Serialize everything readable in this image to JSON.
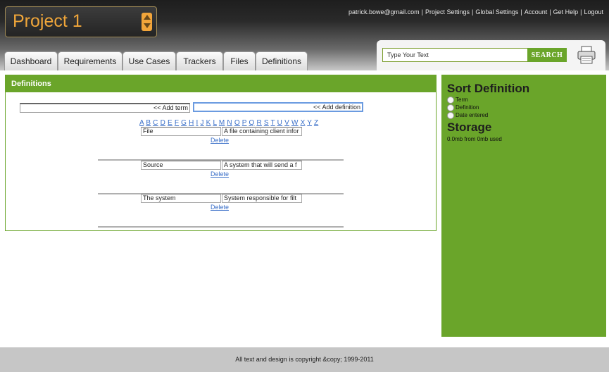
{
  "project": {
    "name": "Project 1"
  },
  "topnav": {
    "email": "patrick.bowe@gmail.com",
    "links": [
      "Project Settings",
      "Global Settings",
      "Account",
      "Get Help",
      "Logout"
    ]
  },
  "tabs": [
    "Dashboard",
    "Requirements",
    "Use Cases",
    "Trackers",
    "Files",
    "Definitions"
  ],
  "search": {
    "placeholder": "Type Your Text",
    "button_label": "SEARCH"
  },
  "definitions": {
    "header": "Definitions",
    "add_term": "<< Add term",
    "add_definition": "<< Add definition",
    "alphabet": [
      "A",
      "B",
      "C",
      "D",
      "E",
      "F",
      "G",
      "H",
      "I",
      "J",
      "K",
      "L",
      "M",
      "N",
      "O",
      "P",
      "Q",
      "R",
      "S",
      "T",
      "U",
      "V",
      "W",
      "X",
      "Y",
      "Z"
    ],
    "entries": [
      {
        "term": "File",
        "definition": "A file containing client infor",
        "delete_label": "Delete"
      },
      {
        "term": "Source",
        "definition": "A system that will send a f",
        "delete_label": "Delete"
      },
      {
        "term": "The system",
        "definition": "System responsible for filt",
        "delete_label": "Delete"
      }
    ]
  },
  "sidebar": {
    "sort_title": "Sort Definition",
    "sort_options": [
      "Term",
      "Definition",
      "Date entered"
    ],
    "storage_title": "Storage",
    "storage_text": "0.0mb from 0mb used"
  },
  "footer": {
    "text": "All text and design is copyright &copy; 1999-2011"
  },
  "colors": {
    "accent_green": "#6aa52a",
    "project_orange": "#f0a63a",
    "link_blue": "#3a6fc8"
  }
}
